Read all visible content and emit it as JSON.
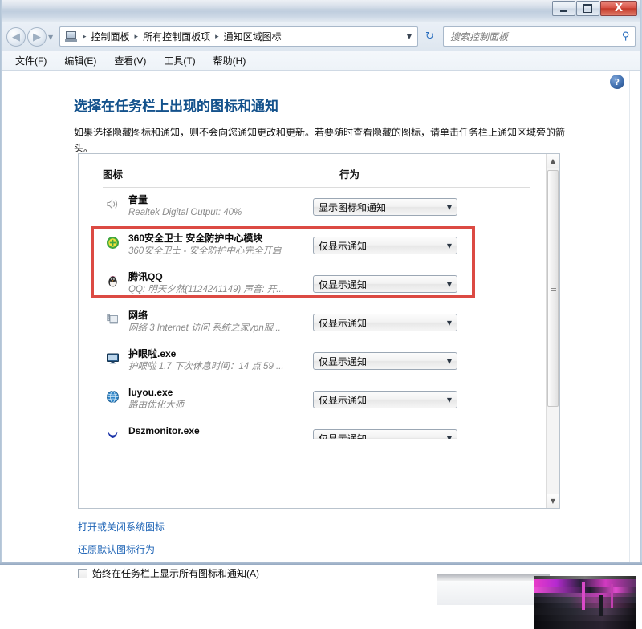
{
  "window": {
    "buttons": {
      "minimize": "Minimize",
      "maximize": "Maximize",
      "close": "X"
    }
  },
  "navigation": {
    "back": "◀",
    "forward": "▶",
    "recent": "▼",
    "breadcrumb": [
      "控制面板",
      "所有控制面板项",
      "通知区域图标"
    ],
    "breadcrumb_separator": "▸",
    "breadcrumb_dropdown": "▼",
    "refresh": "↻"
  },
  "search": {
    "placeholder": "搜索控制面板",
    "value": "",
    "icon": "⚲"
  },
  "menubar": [
    "文件(F)",
    "编辑(E)",
    "查看(V)",
    "工具(T)",
    "帮助(H)"
  ],
  "help": {
    "label": "?"
  },
  "page": {
    "title": "选择在任务栏上出现的图标和通知",
    "description": "如果选择隐藏图标和通知，则不会向您通知更改和更新。若要随时查看隐藏的图标，请单击任务栏上通知区域旁的箭头。"
  },
  "list": {
    "headers": {
      "icon": "图标",
      "behavior": "行为"
    },
    "combo_caret": "▼",
    "rows": [
      {
        "icon": "volume-icon",
        "name": "音量",
        "sub": "Realtek Digital Output: 40%",
        "behavior": "显示图标和通知"
      },
      {
        "icon": "360-shield-icon",
        "name": "360安全卫士 安全防护中心模块",
        "sub": "360安全卫士 - 安全防护中心完全开启",
        "behavior": "仅显示通知"
      },
      {
        "icon": "qq-penguin-icon",
        "name": "腾讯QQ",
        "sub": "QQ: 明天夕然(1124241149)  声音: 开...",
        "behavior": "仅显示通知"
      },
      {
        "icon": "network-icon",
        "name": "网络",
        "sub": "网络 3 Internet 访问 系统之家vpn服...",
        "behavior": "仅显示通知"
      },
      {
        "icon": "monitor-icon",
        "name": "护眼啦.exe",
        "sub": "护眼啦 1.7  下次休息时间：14 点 59 ...",
        "behavior": "仅显示通知"
      },
      {
        "icon": "globe-icon",
        "name": "luyou.exe",
        "sub": "路由优化大师",
        "behavior": "仅显示通知"
      },
      {
        "icon": "dsz-icon",
        "name": "Dszmonitor.exe",
        "sub": "",
        "behavior": "仅显示通知"
      }
    ],
    "scrollbar": {
      "up": "▲",
      "down": "▼"
    }
  },
  "footer": {
    "toggle_system_icons_link": "打开或关闭系统图标",
    "restore_defaults_link": "还原默认图标行为",
    "always_show_checkbox": "始终在任务栏上显示所有图标和通知(A)"
  },
  "colors": {
    "highlight_red": "#dc4a43",
    "link_blue": "#1b62b5",
    "title_blue": "#14528c"
  }
}
